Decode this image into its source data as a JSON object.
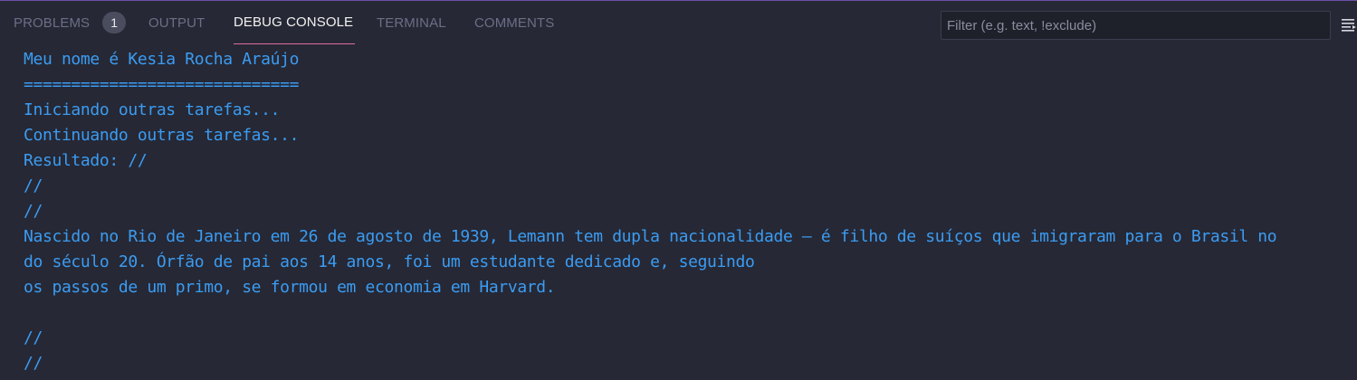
{
  "tabs": [
    {
      "label": "PROBLEMS",
      "badge": "1"
    },
    {
      "label": "OUTPUT"
    },
    {
      "label": "DEBUG CONSOLE",
      "active": true
    },
    {
      "label": "TERMINAL"
    },
    {
      "label": "COMMENTS"
    }
  ],
  "filter": {
    "placeholder": "Filter (e.g. text, !exclude)",
    "value": ""
  },
  "toolbar": {
    "wrap_icon": "word-wrap-icon"
  },
  "colors": {
    "panel_background": "#262835",
    "console_text": "#3b9cf2",
    "active_tab_underline": "#e06c9f",
    "panel_border": "#6b4fa8"
  },
  "console": {
    "lines": [
      "Meu nome é Kesia Rocha Araújo",
      "=============================",
      "Iniciando outras tarefas...",
      "Continuando outras tarefas...",
      "Resultado: //",
      "//",
      "//",
      "Nascido no Rio de Janeiro em 26 de agosto de 1939, Lemann tem dupla nacionalidade – é filho de suíços que imigraram para o Brasil no",
      "do século 20. Órfão de pai aos 14 anos, foi um estudante dedicado e, seguindo",
      "os passos de um primo, se formou em economia em Harvard.",
      "",
      "//",
      "//"
    ]
  }
}
